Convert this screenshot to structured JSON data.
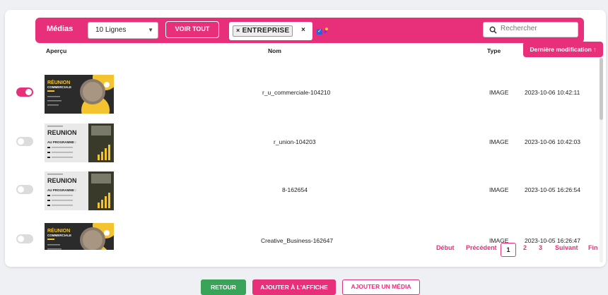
{
  "toolbar": {
    "title": "Médias",
    "rows_select": "10 Lignes",
    "view_all": "VOIR TOUT",
    "tag": "ENTREPRISE",
    "tag_remove": "×",
    "tag_clear": "×",
    "search_placeholder": "Rechercher"
  },
  "table": {
    "headers": {
      "preview": "Aperçu",
      "name": "Nom",
      "type": "Type",
      "modified": "Dernière modification ↑"
    },
    "rows": [
      {
        "enabled": true,
        "name": "r_u_commerciale-104210",
        "type": "IMAGE",
        "modified": "2023-10-06 10:42:11",
        "thumb_style": "dark",
        "thumb_title": "RÉUNION",
        "thumb_sub": "COMMERCIALE"
      },
      {
        "enabled": false,
        "name": "r_union-104203",
        "type": "IMAGE",
        "modified": "2023-10-06 10:42:03",
        "thumb_style": "light",
        "thumb_title": "REUNION",
        "thumb_sub": "AU PROGRAMME :"
      },
      {
        "enabled": false,
        "name": "8-162654",
        "type": "IMAGE",
        "modified": "2023-10-05 16:26:54",
        "thumb_style": "light",
        "thumb_title": "REUNION",
        "thumb_sub": "AU PROGRAMME :"
      },
      {
        "enabled": false,
        "name": "Creative_Business-162647",
        "type": "IMAGE",
        "modified": "2023-10-05 16:26:47",
        "thumb_style": "dark",
        "thumb_title": "RÉUNION",
        "thumb_sub": "COMMERCIALE"
      }
    ]
  },
  "pagination": {
    "first": "Début",
    "prev": "Précédent",
    "pages": [
      "1",
      "2",
      "3"
    ],
    "current": "1",
    "next": "Suivant",
    "last": "Fin"
  },
  "footer": {
    "back": "RETOUR",
    "add_to_display": "AJOUTER À L'AFFICHE",
    "add_media": "AJOUTER UN MÉDIA"
  },
  "colors": {
    "accent": "#e8307a",
    "success": "#3aa35a"
  }
}
